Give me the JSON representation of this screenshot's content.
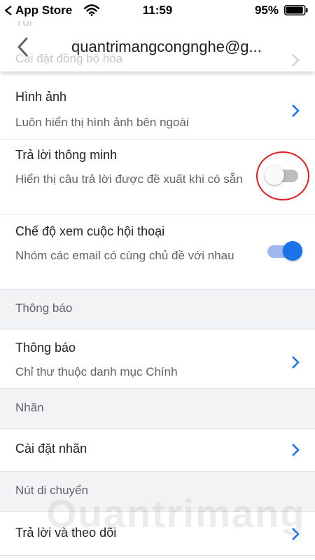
{
  "status_bar": {
    "back_app_label": "App Store",
    "time": "11:59",
    "battery_percent": "95%",
    "battery_level": 0.95
  },
  "header": {
    "ghost_section_text": "Tối",
    "ghost_row_text": "Cài đặt đồng bộ hóa",
    "title": "quantrimangcongnghe@g..."
  },
  "rows": {
    "images": {
      "title": "Hình ảnh",
      "subtitle": "Luôn hiển thị hình ảnh bên ngoài"
    },
    "smart_reply": {
      "title": "Trả lời thông minh",
      "subtitle": "Hiển thị câu trả lời được đề xuất khi có sẵn",
      "enabled": false
    },
    "conversation_view": {
      "title": "Chế độ xem cuộc hội thoại",
      "subtitle": "Nhóm các email có cùng chủ đề với nhau",
      "enabled": true
    },
    "notifications": {
      "title": "Thông báo",
      "subtitle": "Chỉ thư thuộc danh mục Chính"
    },
    "label_settings": {
      "title": "Cài đặt nhãn"
    },
    "reply_follow_up": {
      "title": "Trả lời và theo dõi"
    }
  },
  "sections": {
    "notifications": "Thông báo",
    "labels": "Nhãn",
    "swipe_actions": "Nút di chuyển"
  },
  "watermark": "Quantrimang",
  "colors": {
    "accent": "#1a73e8",
    "highlight": "#e02020"
  }
}
